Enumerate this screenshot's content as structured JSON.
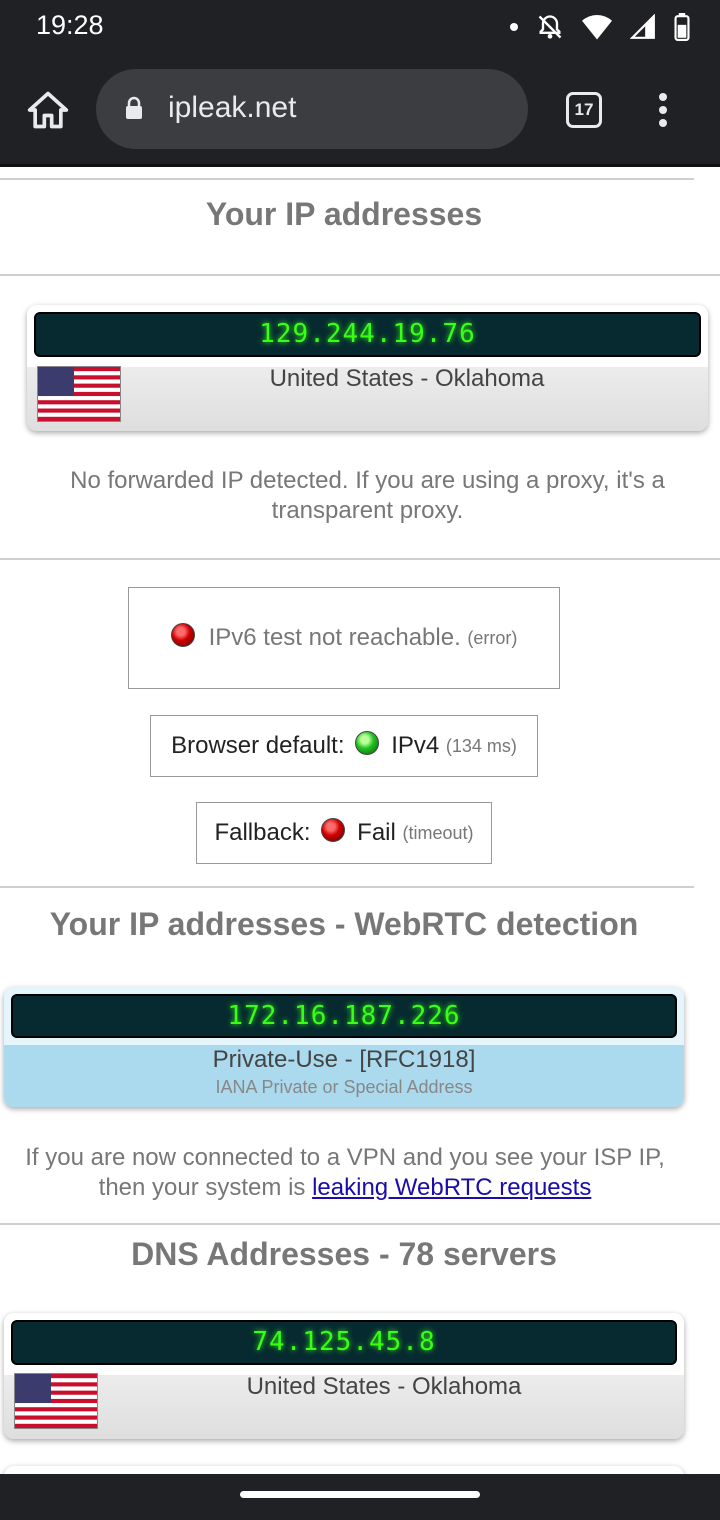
{
  "status_bar": {
    "time": "19:28",
    "icons": [
      "notification-dot-icon",
      "do-not-disturb-icon",
      "wifi-icon",
      "cell-signal-icon",
      "battery-icon"
    ]
  },
  "browser": {
    "url": "ipleak.net",
    "tab_count": "17"
  },
  "ip_section": {
    "title": "Your IP addresses",
    "ip": "129.244.19.76",
    "location": "United States - Oklahoma",
    "forwarded_note": "No forwarded IP detected. If you are using a proxy, it's a transparent proxy."
  },
  "ipv6_test": {
    "label": "IPv6 test not reachable.",
    "detail": "(error)"
  },
  "browser_default": {
    "label": "Browser default:",
    "protocol": "IPv4",
    "detail": "(134 ms)"
  },
  "fallback": {
    "label": "Fallback:",
    "result": "Fail",
    "detail": "(timeout)"
  },
  "webrtc_section": {
    "title": "Your IP addresses - WebRTC detection",
    "ip": "172.16.187.226",
    "type": "Private-Use - [RFC1918]",
    "subtype": "IANA Private or Special Address",
    "note_prefix": "If you are now connected to a VPN and you see your ISP IP, then your system is ",
    "note_link": "leaking WebRTC requests"
  },
  "dns_section": {
    "title": "DNS Addresses - 78 servers",
    "ip": "74.125.45.8",
    "location": "United States - Oklahoma"
  },
  "colors": {
    "chrome_dark": "#202124",
    "lcd_bg": "#062a30",
    "lcd_text": "#39ff14",
    "webrtc_card": "#a8d8ef"
  }
}
